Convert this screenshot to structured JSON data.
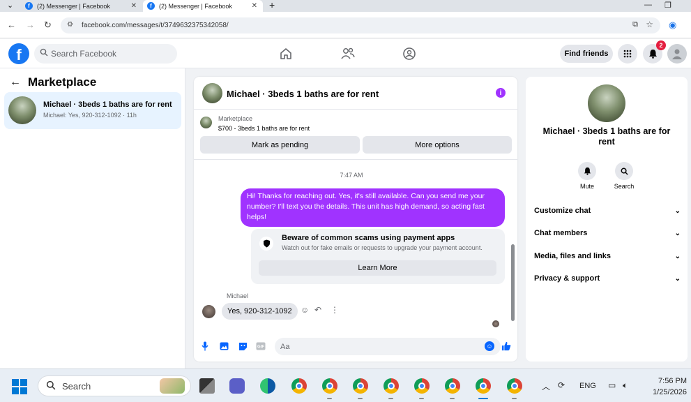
{
  "browser": {
    "tabs": [
      {
        "title": "(2) Messenger | Facebook",
        "active": false
      },
      {
        "title": "(2) Messenger | Facebook",
        "active": true
      }
    ],
    "url": "facebook.com/messages/t/3749632375342058/"
  },
  "fb_header": {
    "logo": "f",
    "search_placeholder": "Search Facebook",
    "find_friends_label": "Find friends",
    "notification_count": "2",
    "nav_icons": [
      "home-icon",
      "friends-icon",
      "groups-icon"
    ]
  },
  "left_panel": {
    "title": "Marketplace",
    "conversations": [
      {
        "name": "Michael · 3beds 1 baths are for rent",
        "preview": "Michael: Yes, 920-312-1092 · 11h",
        "selected": true
      }
    ]
  },
  "chat": {
    "title": "Michael · 3beds 1 baths are for rent",
    "marketplace_label": "Marketplace",
    "listing": "$700 - 3beds 1 baths are for rent",
    "mark_pending_label": "Mark as pending",
    "more_options_label": "More options",
    "timestamp": "7:47 AM",
    "outgoing_message": "Hi! Thanks for reaching out. Yes, it's still available. Can you send me your number? I'll text you the details. This unit has high demand, so acting fast helps!",
    "scam_card": {
      "title": "Beware of common scams using payment apps",
      "subtitle": "Watch out for fake emails or requests to upgrade your payment account.",
      "button": "Learn More"
    },
    "sender_name": "Michael",
    "incoming_message": "Yes, 920-312-1092",
    "composer_placeholder": "Aa",
    "accent_color": "#a033ff"
  },
  "right_panel": {
    "title": "Michael · 3beds 1 baths are for rent",
    "actions": [
      {
        "label": "Mute",
        "icon": "bell-icon"
      },
      {
        "label": "Search",
        "icon": "search-icon"
      }
    ],
    "sections": [
      "Customize chat",
      "Chat members",
      "Media, files and links",
      "Privacy & support"
    ]
  },
  "taskbar": {
    "search_label": "Search",
    "language": "ENG",
    "time": "7:56 PM",
    "date": "1/25/2026"
  }
}
